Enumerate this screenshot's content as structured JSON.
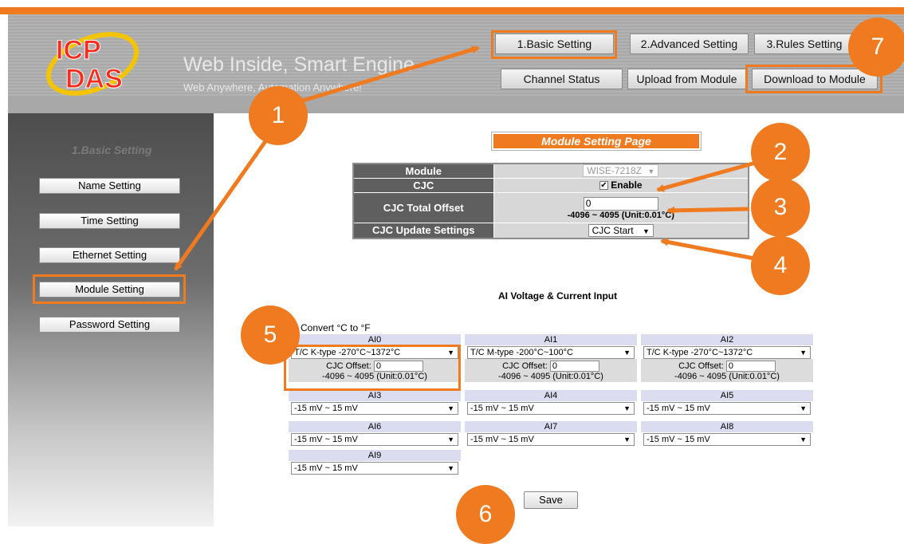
{
  "colors": {
    "accent": "#f07a20",
    "table_label_bg": "#5f5f5f",
    "ai_header_bg": "#dcdcf0"
  },
  "header": {
    "logo_text": "ICP DAS",
    "tagline": "Web Inside, Smart Engine",
    "subtag": "Web Anywhere, Automation Anywhere!",
    "nav": {
      "basic": "1.Basic Setting",
      "advanced": "2.Advanced Setting",
      "rules": "3.Rules Setting",
      "channel_status": "Channel Status",
      "upload": "Upload from Module",
      "download": "Download to Module"
    }
  },
  "sidebar": {
    "title": "1.Basic Setting",
    "items": [
      {
        "label": "Name Setting"
      },
      {
        "label": "Time Setting"
      },
      {
        "label": "Ethernet Setting"
      },
      {
        "label": "Module Setting"
      },
      {
        "label": "Password Setting"
      }
    ]
  },
  "main": {
    "page_title": "Module Setting Page",
    "module_table": {
      "module_label": "Module",
      "module_value": "WISE-7218Z",
      "cjc_label": "CJC",
      "cjc_enable_label": "Enable",
      "cjc_enabled": true,
      "offset_label": "CJC Total Offset",
      "offset_value": "0",
      "offset_range": "-4096 ~ 4095 (Unit:0.01°C)",
      "update_label": "CJC Update Settings",
      "update_value": "CJC Start"
    },
    "ai_heading": "AI Voltage & Current Input",
    "convert_label": "Convert °C to °F",
    "channels": [
      {
        "name": "AI0",
        "type": "T/C K-type -270°C~1372°C",
        "cjc_offset_label": "CJC Offset:",
        "cjc_offset": "0",
        "range": "-4096 ~ 4095 (Unit:0.01°C)"
      },
      {
        "name": "AI1",
        "type": "T/C M-type -200°C~100°C",
        "cjc_offset_label": "CJC Offset:",
        "cjc_offset": "0",
        "range": "-4096 ~ 4095 (Unit:0.01°C)"
      },
      {
        "name": "AI2",
        "type": "T/C K-type -270°C~1372°C",
        "cjc_offset_label": "CJC Offset:",
        "cjc_offset": "0",
        "range": "-4096 ~ 4095 (Unit:0.01°C)"
      },
      {
        "name": "AI3",
        "type": "-15 mV ~ 15 mV"
      },
      {
        "name": "AI4",
        "type": "-15 mV ~ 15 mV"
      },
      {
        "name": "AI5",
        "type": "-15 mV ~ 15 mV"
      },
      {
        "name": "AI6",
        "type": "-15 mV ~ 15 mV"
      },
      {
        "name": "AI7",
        "type": "-15 mV ~ 15 mV"
      },
      {
        "name": "AI8",
        "type": "-15 mV ~ 15 mV"
      },
      {
        "name": "AI9",
        "type": "-15 mV ~ 15 mV"
      }
    ],
    "save_label": "Save"
  },
  "annotations": {
    "badges": [
      "1",
      "2",
      "3",
      "4",
      "5",
      "6",
      "7"
    ]
  }
}
